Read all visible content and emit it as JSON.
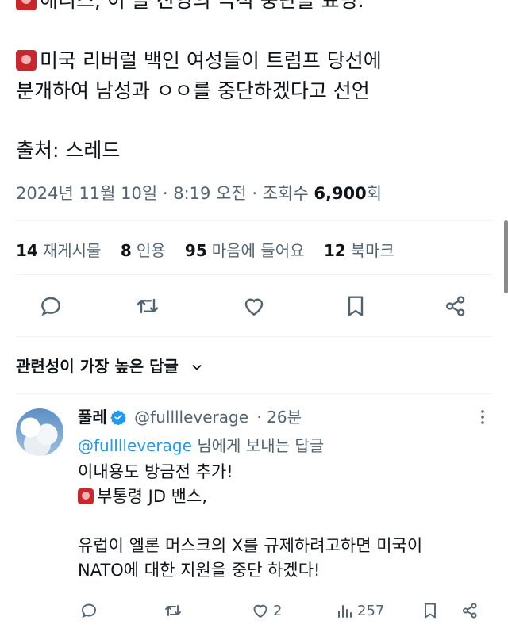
{
  "tweet": {
    "cut_line": "해리스, 이 들 진영의 극적 중단을 표명.",
    "lines": [
      "미국 리버럴 백인 여성들이 트럼프 당선에",
      "분개하여 남성과 ㅇㅇ를 중단하겠다고 선언"
    ],
    "source": "출처: 스레드",
    "meta": {
      "date_time": "2024년 11월 10일 · 8:19 오전 · 조회수 ",
      "views_number": "6,900",
      "views_suffix": "회"
    },
    "stats": [
      {
        "count": "14",
        "label": "재게시물"
      },
      {
        "count": "8",
        "label": "인용"
      },
      {
        "count": "95",
        "label": "마음에 들어요"
      },
      {
        "count": "12",
        "label": "북마크"
      }
    ],
    "actions": [
      "reply-icon",
      "retweet-icon",
      "like-icon",
      "bookmark-icon",
      "share-icon"
    ]
  },
  "replies_section": {
    "header": "관련성이 가장 높은 답글"
  },
  "reply": {
    "display_name": "풀레",
    "handle": "@fulllleverage",
    "time": "· 26분",
    "reply_to_link": "@fulllleverage",
    "reply_to_suffix": " 님에게 보내는 답글",
    "body": [
      "이내용도 방금전 추가!",
      "부통령 JD 밴스,",
      "",
      "유럽이 엘론 머스크의 X를 규제하려고하면 미국이",
      "NATO에 대한 지원을 중단 하겠다!"
    ],
    "like_count": "2",
    "view_count": "257"
  },
  "colors": {
    "text": "#0f1419",
    "secondary": "#536471",
    "link": "#1d9bf0",
    "verified": "#1d9bf0",
    "siren": "#c8282b"
  }
}
